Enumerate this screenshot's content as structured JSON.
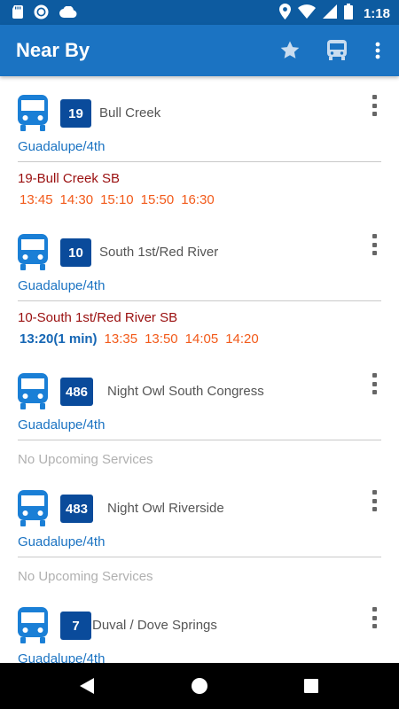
{
  "status_bar": {
    "time": "1:18",
    "left_icons": [
      "sd-card-icon",
      "record-icon",
      "cloud-icon"
    ],
    "right_icons": [
      "location-icon",
      "wifi-icon",
      "signal-icon",
      "battery-icon"
    ]
  },
  "app_bar": {
    "title": "Near By",
    "actions": [
      "star-icon",
      "bus-icon",
      "more-vert-icon"
    ]
  },
  "colors": {
    "status_bar": "#0d5ba0",
    "app_bar": "#1b73c2",
    "badge": "#0a4b9b",
    "stop": "#1b73c2",
    "direction": "#9a0f0f",
    "times": "#f25a1a",
    "next_time": "#1566b4",
    "no_service": "#b0b0b0"
  },
  "routes": [
    {
      "number": "19",
      "name": "Bull Creek",
      "stop": "Guadalupe/4th",
      "direction": "19-Bull Creek SB",
      "times": [
        "13:45",
        "14:30",
        "15:10",
        "15:50",
        "16:30"
      ]
    },
    {
      "number": "10",
      "name": "South 1st/Red River",
      "stop": "Guadalupe/4th",
      "direction": "10-South 1st/Red River SB",
      "next_time": "13:20(1 min)",
      "times": [
        "13:35",
        "13:50",
        "14:05",
        "14:20"
      ]
    },
    {
      "number": "486",
      "name": "Night Owl South Congress",
      "stop": "Guadalupe/4th",
      "no_service": "No Upcoming Services"
    },
    {
      "number": "483",
      "name": "Night Owl Riverside",
      "stop": "Guadalupe/4th",
      "no_service": "No Upcoming Services"
    },
    {
      "number": "7",
      "name": "Duval / Dove Springs",
      "stop": "Guadalupe/4th"
    }
  ],
  "nav_bar": {
    "buttons": [
      "back-icon",
      "home-icon",
      "recents-icon"
    ]
  }
}
